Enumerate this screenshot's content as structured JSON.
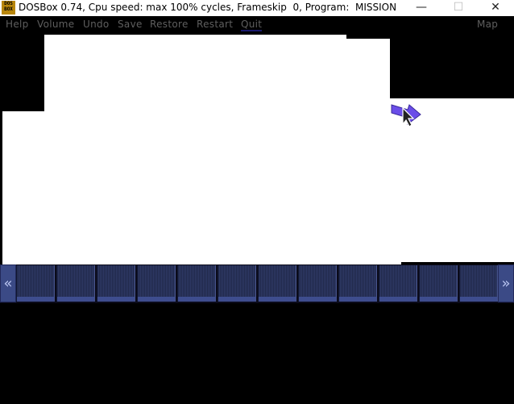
{
  "window": {
    "title": "DOSBox 0.74, Cpu speed: max 100% cycles, Frameskip  0, Program:  MISSION",
    "icon_top": "DOS",
    "icon_bottom": "BOX",
    "minimize_glyph": "—",
    "maximize_glyph": "☐",
    "close_glyph": "✕"
  },
  "menu": {
    "items": [
      "Help",
      "Volume",
      "Undo",
      "Save",
      "Restore",
      "Restart",
      "Quit"
    ],
    "map_label": "Map"
  },
  "toolbar": {
    "left_glyph": "«",
    "right_glyph": "»",
    "slot_count": 12
  },
  "colors": {
    "menu_text": "#5f5f5f",
    "toolbar_slot": "#2f3a66",
    "cursor_arrow": "#7b5cf0"
  },
  "icons": {
    "cursor": "pointer-arrow-icon"
  }
}
